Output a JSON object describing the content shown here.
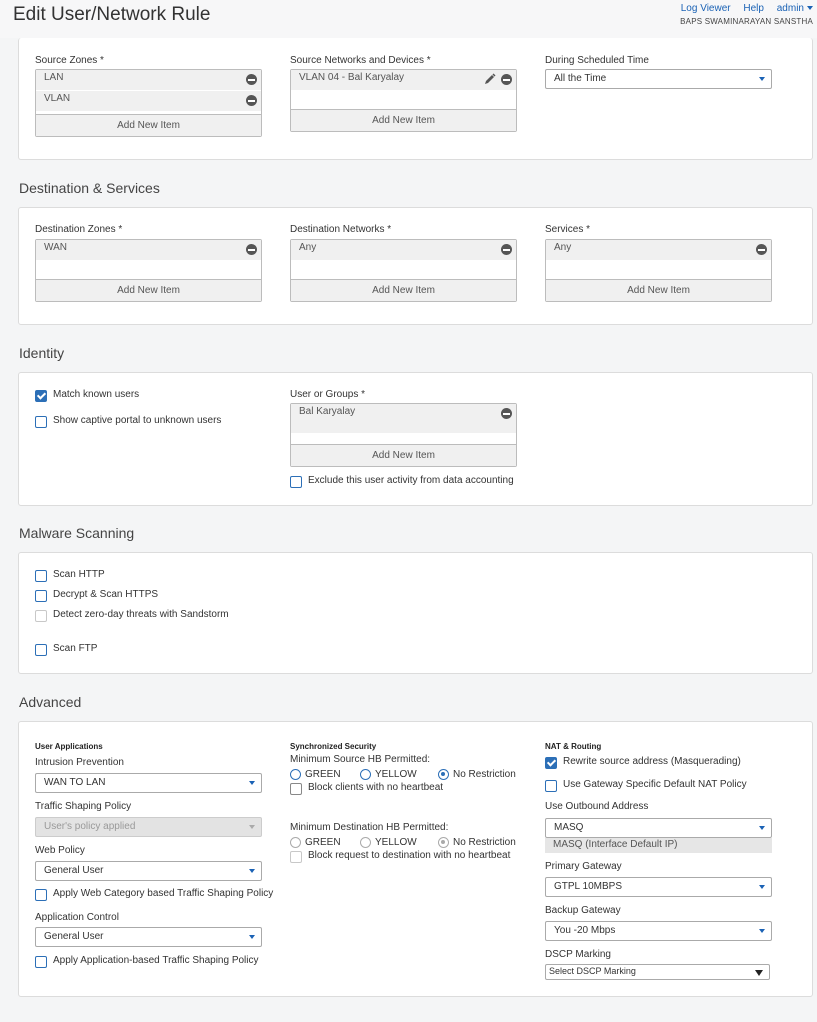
{
  "header": {
    "title": "Edit User/Network Rule",
    "links": {
      "log_viewer": "Log Viewer",
      "help": "Help",
      "admin": "admin"
    },
    "org": "BAPS SWAMINARAYAN SANSTHA"
  },
  "source": {
    "zones_label": "Source Zones *",
    "zones": [
      "LAN",
      "VLAN"
    ],
    "networks_label": "Source Networks and Devices *",
    "networks": [
      "VLAN 04 - Bal Karyalay"
    ],
    "schedule_label": "During Scheduled Time",
    "schedule_value": "All the Time",
    "add_new": "Add New Item"
  },
  "destination": {
    "title": "Destination & Services",
    "zones_label": "Destination Zones *",
    "zones": [
      "WAN"
    ],
    "networks_label": "Destination Networks *",
    "networks": [
      "Any"
    ],
    "services_label": "Services *",
    "services": [
      "Any"
    ],
    "add_new": "Add New Item"
  },
  "identity": {
    "title": "Identity",
    "match_known": "Match known users",
    "captive_portal": "Show captive portal to unknown users",
    "groups_label": "User or Groups *",
    "groups": [
      "Bal Karyalay"
    ],
    "add_new": "Add New Item",
    "exclude": "Exclude this user activity from data accounting"
  },
  "malware": {
    "title": "Malware Scanning",
    "scan_http": "Scan HTTP",
    "decrypt_https": "Decrypt & Scan HTTPS",
    "sandstorm": "Detect zero-day threats with Sandstorm",
    "scan_ftp": "Scan FTP"
  },
  "advanced": {
    "title": "Advanced",
    "user_apps": {
      "heading": "User Applications",
      "ips_label": "Intrusion Prevention",
      "ips_value": "WAN TO LAN",
      "shaping_label": "Traffic Shaping Policy",
      "shaping_value": "User's policy applied",
      "web_label": "Web Policy",
      "web_value": "General User",
      "web_shaping": "Apply Web Category based Traffic Shaping Policy",
      "app_label": "Application Control",
      "app_value": "General User",
      "app_shaping": "Apply Application-based Traffic Shaping Policy"
    },
    "sync_security": {
      "heading": "Synchronized Security",
      "min_source_label": "Minimum Source HB Permitted:",
      "min_dest_label": "Minimum Destination HB Permitted:",
      "green": "GREEN",
      "yellow": "YELLOW",
      "no_restriction": "No Restriction",
      "block_clients": "Block clients with no heartbeat",
      "block_dest": "Block request to destination with no heartbeat"
    },
    "nat": {
      "heading": "NAT & Routing",
      "rewrite": "Rewrite source address (Masquerading)",
      "gateway_nat": "Use Gateway Specific Default NAT Policy",
      "outbound_label": "Use Outbound Address",
      "outbound_value": "MASQ",
      "outbound_note": "MASQ (Interface Default IP)",
      "primary_label": "Primary Gateway",
      "primary_value": "GTPL 10MBPS",
      "backup_label": "Backup Gateway",
      "backup_value": "You -20 Mbps",
      "dscp_label": "DSCP Marking",
      "dscp_value": "Select DSCP Marking"
    }
  },
  "colors": {
    "accent": "#2c6fb7",
    "link": "#1a62b5"
  }
}
